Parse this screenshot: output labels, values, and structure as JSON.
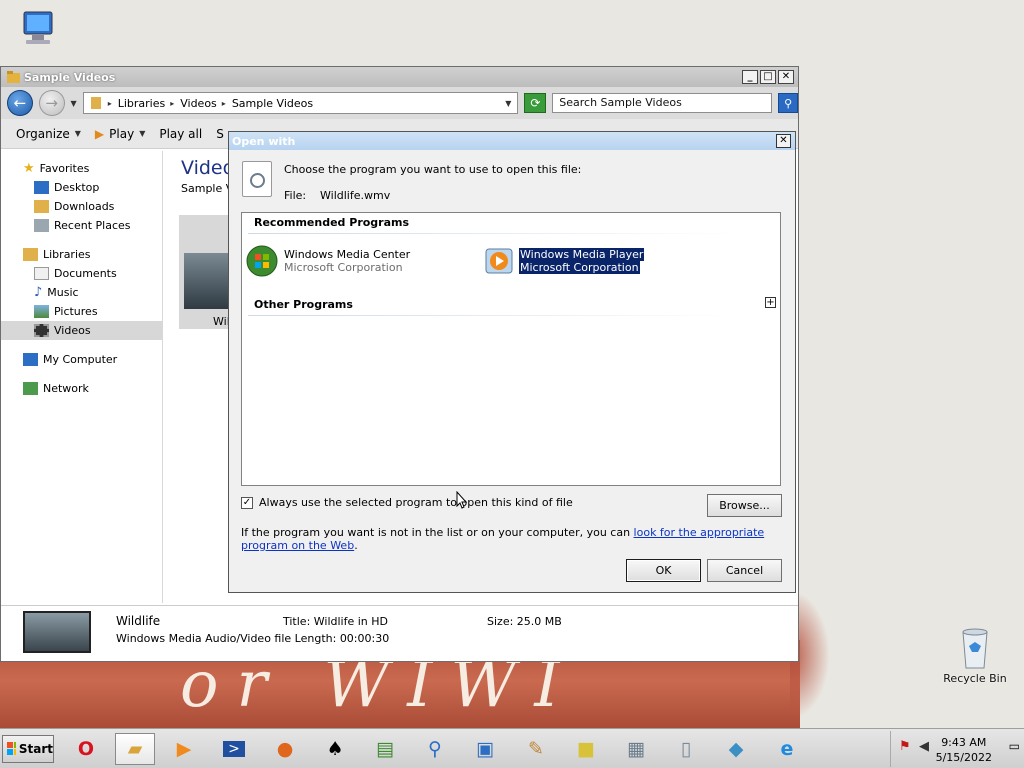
{
  "desktop": {
    "computer_icon_label": "My Computer",
    "recycle_bin_label": "Recycle Bin",
    "wallpaper_text": "or WIWI"
  },
  "explorer": {
    "title": "Sample Videos",
    "address": [
      "Libraries",
      "Videos",
      "Sample Videos"
    ],
    "search_placeholder": "Search Sample Videos",
    "toolbar": {
      "organize": "Organize",
      "play": "Play",
      "play_all": "Play all",
      "more": "S"
    },
    "nav": {
      "favorites": "Favorites",
      "favorites_items": [
        "Desktop",
        "Downloads",
        "Recent Places"
      ],
      "libraries": "Libraries",
      "libraries_items": [
        "Documents",
        "Music",
        "Pictures",
        "Videos"
      ],
      "computer": "My Computer",
      "network": "Network"
    },
    "content": {
      "heading": "Videos",
      "subheading": "Sample Videos",
      "thumb_label": "Wil"
    },
    "details": {
      "name": "Wildlife",
      "type_length": "Windows Media Audio/Video file Length: 00:00:30",
      "title": "Title: Wildlife in HD",
      "size": "Size: 25.0 MB"
    }
  },
  "dialog": {
    "title": "Open with",
    "prompt": "Choose the program you want to use to open this file:",
    "file_label": "File:",
    "file_name": "Wildlife.wmv",
    "recommended_header": "Recommended Programs",
    "other_header": "Other Programs",
    "programs": [
      {
        "name": "Windows Media Center",
        "publisher": "Microsoft Corporation",
        "selected": false
      },
      {
        "name": "Windows Media Player",
        "publisher": "Microsoft Corporation",
        "selected": true
      }
    ],
    "always_use_label": "Always use the selected program to open this kind of file",
    "always_use_checked": true,
    "browse_label": "Browse...",
    "info_text": "If the program you want is not in the list or on your computer, you can ",
    "info_link": "look for the appropriate program on the Web",
    "info_end": ".",
    "ok_label": "OK",
    "cancel_label": "Cancel"
  },
  "taskbar": {
    "start_label": "Start",
    "time": "9:43 AM",
    "date": "5/15/2022"
  }
}
